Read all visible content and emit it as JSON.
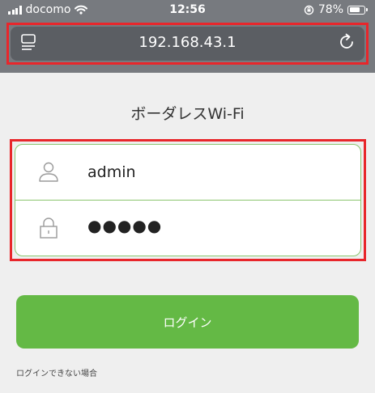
{
  "status_bar": {
    "carrier": "docomo",
    "time": "12:56",
    "battery": "78%",
    "battery_level": 0.78,
    "icons": [
      "signal-bars-icon",
      "wifi-icon",
      "orientation-lock-icon",
      "battery-icon"
    ]
  },
  "browser": {
    "address": "192.168.43.1",
    "left_icon": "reader-view-icon",
    "right_icon": "reload-icon"
  },
  "page": {
    "title": "ボーダレスWi-Fi",
    "username_value": "admin",
    "password_value": "●●●●●",
    "login_label": "ログイン",
    "help_link": "ログインできない場合"
  },
  "colors": {
    "highlight_border": "#e8262b",
    "accent_green": "#64b945",
    "field_border": "#8cc56f"
  }
}
